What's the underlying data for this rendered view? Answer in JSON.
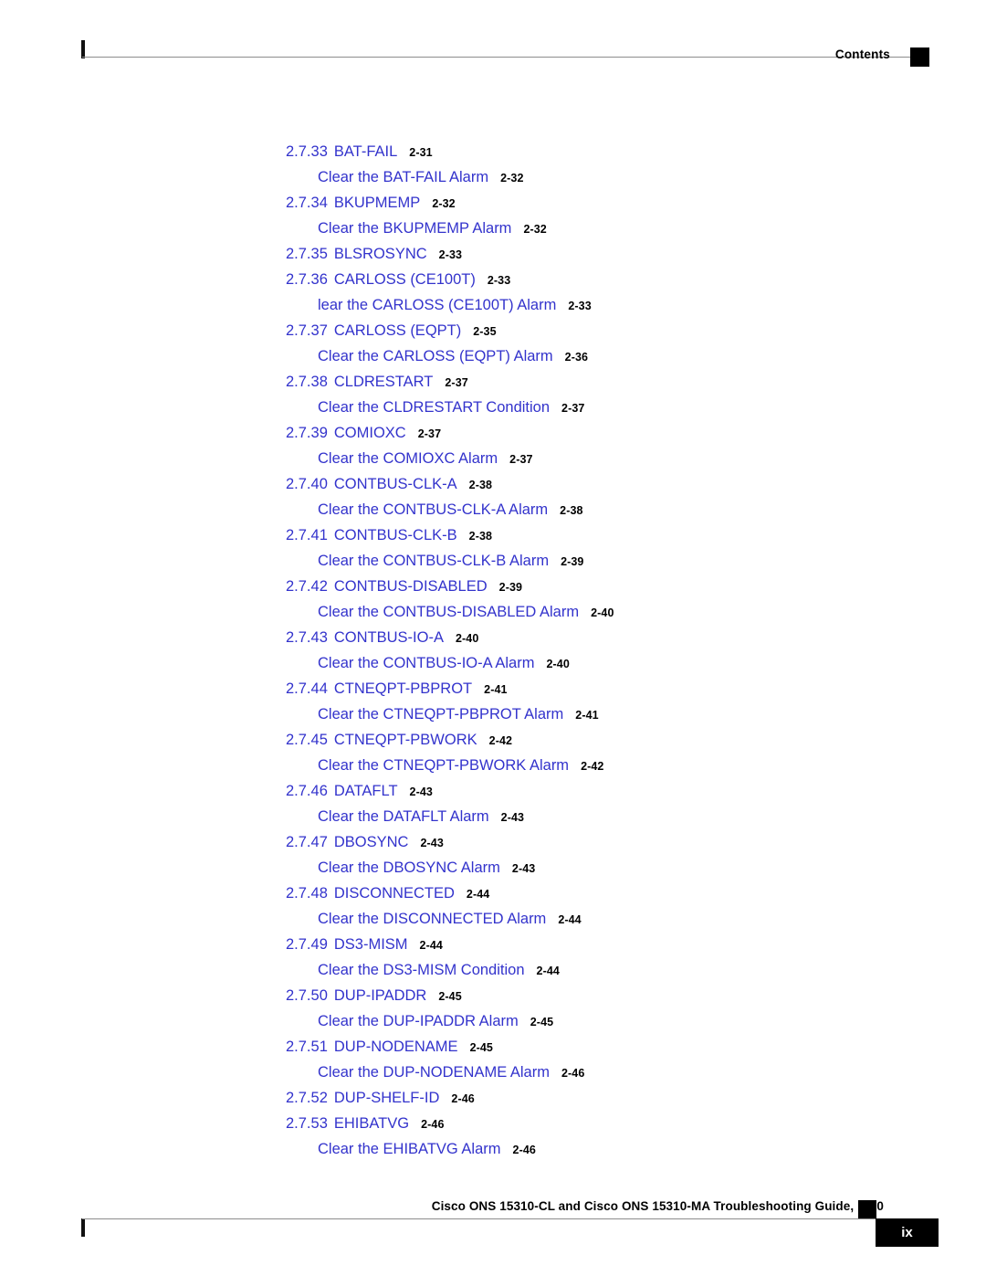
{
  "header": {
    "label": "Contents",
    "square_icon": "black-square-marker"
  },
  "footer": {
    "title": "Cisco ONS 15310-CL and Cisco ONS 15310-MA Troubleshooting Guide, R7.0",
    "square_icon": "black-square-marker",
    "page_number": "ix"
  },
  "colors": {
    "link_blue": "#3333cc",
    "page_number_black": "#000000",
    "rule_gray": "#8c8c8c",
    "marker_black": "#000000"
  },
  "toc": {
    "entries": [
      {
        "level": 1,
        "number": "2.7.33",
        "title": "BAT-FAIL",
        "page": "2-31"
      },
      {
        "level": 2,
        "number": "",
        "title": "Clear the BAT-FAIL Alarm",
        "page": "2-32"
      },
      {
        "level": 1,
        "number": "2.7.34",
        "title": "BKUPMEMP",
        "page": "2-32"
      },
      {
        "level": 2,
        "number": "",
        "title": "Clear the BKUPMEMP Alarm",
        "page": "2-32"
      },
      {
        "level": 1,
        "number": "2.7.35",
        "title": "BLSROSYNC",
        "page": "2-33"
      },
      {
        "level": 1,
        "number": "2.7.36",
        "title": "CARLOSS (CE100T)",
        "page": "2-33"
      },
      {
        "level": 2,
        "number": "",
        "title": "lear the CARLOSS (CE100T) Alarm",
        "page": "2-33"
      },
      {
        "level": 1,
        "number": "2.7.37",
        "title": "CARLOSS (EQPT)",
        "page": "2-35"
      },
      {
        "level": 2,
        "number": "",
        "title": "Clear the CARLOSS (EQPT) Alarm",
        "page": "2-36"
      },
      {
        "level": 1,
        "number": "2.7.38",
        "title": "CLDRESTART",
        "page": "2-37"
      },
      {
        "level": 2,
        "number": "",
        "title": "Clear the CLDRESTART Condition",
        "page": "2-37"
      },
      {
        "level": 1,
        "number": "2.7.39",
        "title": "COMIOXC",
        "page": "2-37"
      },
      {
        "level": 2,
        "number": "",
        "title": "Clear the COMIOXC Alarm",
        "page": "2-37"
      },
      {
        "level": 1,
        "number": "2.7.40",
        "title": "CONTBUS-CLK-A",
        "page": "2-38"
      },
      {
        "level": 2,
        "number": "",
        "title": "Clear the CONTBUS-CLK-A Alarm",
        "page": "2-38"
      },
      {
        "level": 1,
        "number": "2.7.41",
        "title": "CONTBUS-CLK-B",
        "page": "2-38"
      },
      {
        "level": 2,
        "number": "",
        "title": "Clear the CONTBUS-CLK-B Alarm",
        "page": "2-39"
      },
      {
        "level": 1,
        "number": "2.7.42",
        "title": "CONTBUS-DISABLED",
        "page": "2-39"
      },
      {
        "level": 2,
        "number": "",
        "title": "Clear the CONTBUS-DISABLED Alarm",
        "page": "2-40"
      },
      {
        "level": 1,
        "number": "2.7.43",
        "title": "CONTBUS-IO-A",
        "page": "2-40"
      },
      {
        "level": 2,
        "number": "",
        "title": "Clear the CONTBUS-IO-A Alarm",
        "page": "2-40"
      },
      {
        "level": 1,
        "number": "2.7.44",
        "title": "CTNEQPT-PBPROT",
        "page": "2-41"
      },
      {
        "level": 2,
        "number": "",
        "title": "Clear the CTNEQPT-PBPROT Alarm",
        "page": "2-41"
      },
      {
        "level": 1,
        "number": "2.7.45",
        "title": "CTNEQPT-PBWORK",
        "page": "2-42"
      },
      {
        "level": 2,
        "number": "",
        "title": "Clear the CTNEQPT-PBWORK Alarm",
        "page": "2-42"
      },
      {
        "level": 1,
        "number": "2.7.46",
        "title": "DATAFLT",
        "page": "2-43"
      },
      {
        "level": 2,
        "number": "",
        "title": "Clear the DATAFLT Alarm",
        "page": "2-43"
      },
      {
        "level": 1,
        "number": "2.7.47",
        "title": "DBOSYNC",
        "page": "2-43"
      },
      {
        "level": 2,
        "number": "",
        "title": "Clear the DBOSYNC Alarm",
        "page": "2-43"
      },
      {
        "level": 1,
        "number": "2.7.48",
        "title": "DISCONNECTED",
        "page": "2-44"
      },
      {
        "level": 2,
        "number": "",
        "title": "Clear the DISCONNECTED Alarm",
        "page": "2-44"
      },
      {
        "level": 1,
        "number": "2.7.49",
        "title": "DS3-MISM",
        "page": "2-44"
      },
      {
        "level": 2,
        "number": "",
        "title": "Clear the DS3-MISM Condition",
        "page": "2-44"
      },
      {
        "level": 1,
        "number": "2.7.50",
        "title": "DUP-IPADDR",
        "page": "2-45"
      },
      {
        "level": 2,
        "number": "",
        "title": "Clear the DUP-IPADDR Alarm",
        "page": "2-45"
      },
      {
        "level": 1,
        "number": "2.7.51",
        "title": "DUP-NODENAME",
        "page": "2-45"
      },
      {
        "level": 2,
        "number": "",
        "title": "Clear the DUP-NODENAME Alarm",
        "page": "2-46"
      },
      {
        "level": 1,
        "number": "2.7.52",
        "title": "DUP-SHELF-ID",
        "page": "2-46"
      },
      {
        "level": 1,
        "number": "2.7.53",
        "title": "EHIBATVG",
        "page": "2-46"
      },
      {
        "level": 2,
        "number": "",
        "title": "Clear the EHIBATVG Alarm",
        "page": "2-46"
      }
    ]
  }
}
